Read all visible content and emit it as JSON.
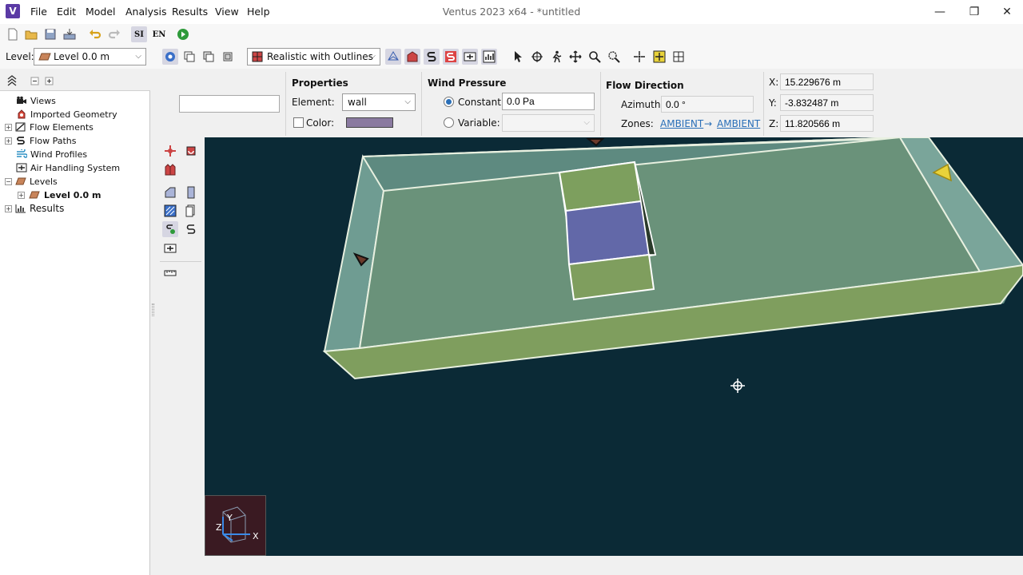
{
  "app": {
    "title": "Ventus 2023 x64 - *untitled",
    "icon_letter": "V"
  },
  "menu": [
    "File",
    "Edit",
    "Model",
    "Analysis",
    "Results",
    "View",
    "Help"
  ],
  "window_controls": {
    "minimize": "—",
    "maximize": "❐",
    "close": "✕"
  },
  "toolbar1": {
    "si_label": "SI",
    "en_label": "EN"
  },
  "toolbar2": {
    "level_label": "Level:",
    "level_value": "Level 0.0 m",
    "render_mode": "Realistic with Outlines"
  },
  "tree": {
    "items": [
      {
        "label": "Views",
        "icon": "camera-icon"
      },
      {
        "label": "Imported Geometry",
        "icon": "geometry-icon"
      },
      {
        "label": "Flow Elements",
        "icon": "flow-element-icon"
      },
      {
        "label": "Flow Paths",
        "icon": "flow-path-icon"
      },
      {
        "label": "Wind Profiles",
        "icon": "wind-icon"
      },
      {
        "label": "Air Handling System",
        "icon": "ahs-icon"
      },
      {
        "label": "Levels",
        "icon": "level-icon"
      },
      {
        "label": "Level 0.0 m",
        "icon": "level-icon"
      },
      {
        "label": "Results",
        "icon": "chart-icon"
      }
    ]
  },
  "properties": {
    "title": "Properties",
    "element_label": "Element:",
    "element_value": "wall",
    "color_label": "Color:",
    "color_value": "#8a7aa0",
    "name_value": ""
  },
  "wind_pressure": {
    "title": "Wind Pressure",
    "constant_label": "Constant:",
    "constant_value": "0.0 Pa",
    "variable_label": "Variable:",
    "variable_value": ""
  },
  "flow_direction": {
    "title": "Flow Direction",
    "azimuth_label": "Azimuth:",
    "azimuth_value": "0.0 °",
    "zones_label": "Zones:",
    "zone_from": "AMBIENT",
    "zone_arrow": "→",
    "zone_to": "AMBIENT"
  },
  "coordinates": {
    "x_label": "X:",
    "x_value": "15.229676 m",
    "y_label": "Y:",
    "y_value": "-3.832487 m",
    "z_label": "Z:",
    "z_value": "11.820566 m"
  },
  "axes": {
    "x": "X",
    "y": "Y",
    "z": "Z"
  },
  "colors": {
    "viewport_bg": "#0b2a36",
    "accent": "#2a6fb8",
    "floor": "#6e9378",
    "wall": "#9fbf8a",
    "opening": "#6268a8"
  }
}
